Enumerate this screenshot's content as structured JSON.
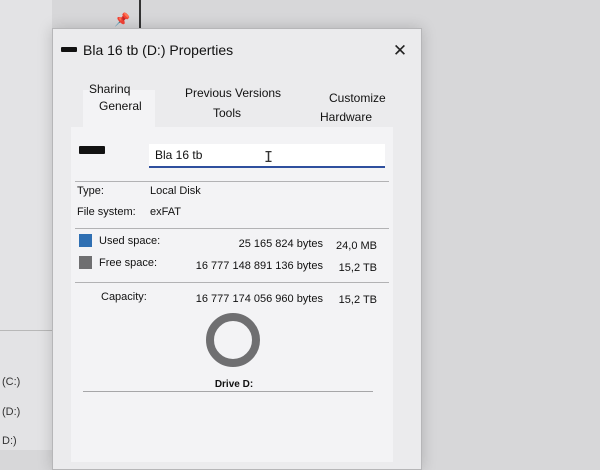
{
  "background": {
    "drives": [
      "(C:)",
      "(D:)",
      "D:)"
    ]
  },
  "dialog": {
    "title": "Bla 16 tb (D:) Properties",
    "close_icon": "close-icon",
    "tabs": {
      "sharing": "Sharinq",
      "previous_versions": "Previous Versions",
      "customize": "Customize",
      "general": "General",
      "tools": "Tools",
      "hardware": "Hardware"
    },
    "active_tab": "General",
    "name_value": "Bla 16 tb",
    "type_label": "Type:",
    "type_value": "Local Disk",
    "fs_label": "File system:",
    "fs_value": "exFAT",
    "used_label": "Used space:",
    "used_bytes": "25 165 824 bytes",
    "used_short": "24,0 MB",
    "free_label": "Free space:",
    "free_bytes": "16 777 148 891 136 bytes",
    "free_short": "15,2 TB",
    "capacity_label": "Capacity:",
    "capacity_bytes": "16 777 174 056 960 bytes",
    "capacity_short": "15,2 TB",
    "drive_label": "Drive D:",
    "colors": {
      "used": "#2f6fb2",
      "free": "#6f6f71",
      "accent": "#2e4f9e"
    }
  }
}
